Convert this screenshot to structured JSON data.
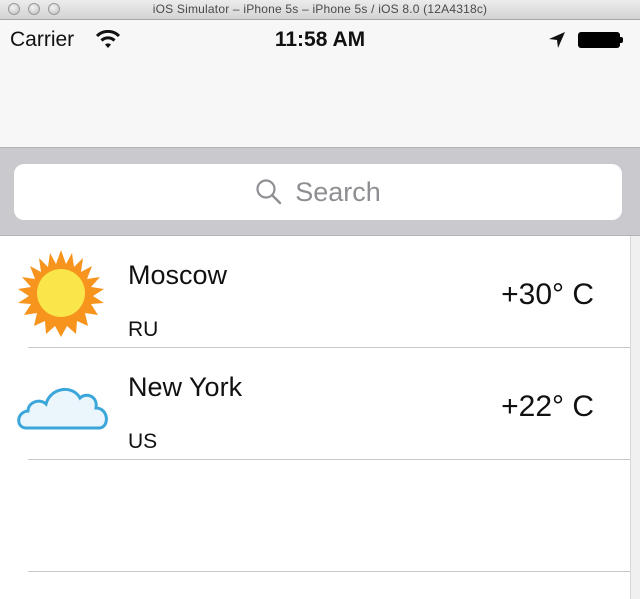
{
  "window": {
    "title": "iOS Simulator – iPhone 5s – iPhone 5s / iOS 8.0 (12A4318c)"
  },
  "status_bar": {
    "carrier": "Carrier",
    "time": "11:58 AM"
  },
  "search": {
    "placeholder": "Search"
  },
  "cities": [
    {
      "name": "Moscow",
      "country": "RU",
      "temperature": "+30° C",
      "icon": "sun-icon"
    },
    {
      "name": "New York",
      "country": "US",
      "temperature": "+22° C",
      "icon": "cloud-icon"
    }
  ],
  "colors": {
    "search_bar_bg": "#c9c9ce",
    "sun": "#f7941d",
    "cloud": "#3aa6d9"
  }
}
